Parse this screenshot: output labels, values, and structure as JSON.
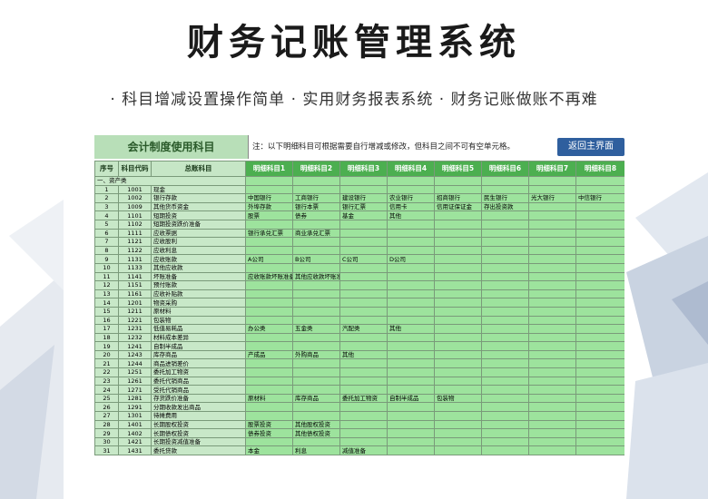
{
  "hero": {
    "title": "财务记账管理系统",
    "subtitle": "· 科目增减设置操作简单  ·  实用财务报表系统 · 财务记账做账不再难"
  },
  "sheet": {
    "title": "会计制度使用科目",
    "note": "注：以下明细科目可根据需要自行增减或修改，但科目之间不可有空单元格。",
    "back_button": "返回主界面",
    "headers": [
      "序号",
      "科目代码",
      "总账科目",
      "明细科目1",
      "明细科目2",
      "明细科目3",
      "明细科目4",
      "明细科目5",
      "明细科目6",
      "明细科目7",
      "明细科目8"
    ],
    "section": "一、资产类",
    "rows": [
      {
        "seq": "1",
        "code": "1001",
        "name": "现金",
        "details": []
      },
      {
        "seq": "2",
        "code": "1002",
        "name": "银行存款",
        "details": [
          "中国银行",
          "工商银行",
          "建设银行",
          "农业银行",
          "招商银行",
          "民生银行",
          "光大银行",
          "中信银行"
        ]
      },
      {
        "seq": "3",
        "code": "1009",
        "name": "其他货币资金",
        "details": [
          "外埠存款",
          "银行本票",
          "银行汇票",
          "信用卡",
          "信用证保证金",
          "存出投资款"
        ]
      },
      {
        "seq": "4",
        "code": "1101",
        "name": "短期投资",
        "details": [
          "股票",
          "债券",
          "基金",
          "其他"
        ]
      },
      {
        "seq": "5",
        "code": "1102",
        "name": "短期投资跌价准备",
        "details": []
      },
      {
        "seq": "6",
        "code": "1111",
        "name": "应收票据",
        "details": [
          "银行承兑汇票",
          "商业承兑汇票"
        ]
      },
      {
        "seq": "7",
        "code": "1121",
        "name": "应收股利",
        "details": []
      },
      {
        "seq": "8",
        "code": "1122",
        "name": "应收利息",
        "details": []
      },
      {
        "seq": "9",
        "code": "1131",
        "name": "应收账款",
        "details": [
          "A公司",
          "B公司",
          "C公司",
          "D公司"
        ]
      },
      {
        "seq": "10",
        "code": "1133",
        "name": "其他应收款",
        "details": []
      },
      {
        "seq": "11",
        "code": "1141",
        "name": "坏账准备",
        "details": [
          "应收账款坏账准备",
          "其他应收款坏账准备"
        ]
      },
      {
        "seq": "12",
        "code": "1151",
        "name": "预付账款",
        "details": []
      },
      {
        "seq": "13",
        "code": "1161",
        "name": "应收补贴款",
        "details": []
      },
      {
        "seq": "14",
        "code": "1201",
        "name": "物资采购",
        "details": []
      },
      {
        "seq": "15",
        "code": "1211",
        "name": "原材料",
        "details": []
      },
      {
        "seq": "16",
        "code": "1221",
        "name": "包装物",
        "details": []
      },
      {
        "seq": "17",
        "code": "1231",
        "name": "低值易耗品",
        "details": [
          "办公类",
          "五金类",
          "汽配类",
          "其他"
        ]
      },
      {
        "seq": "18",
        "code": "1232",
        "name": "材料成本差异",
        "details": []
      },
      {
        "seq": "19",
        "code": "1241",
        "name": "自制半成品",
        "details": []
      },
      {
        "seq": "20",
        "code": "1243",
        "name": "库存商品",
        "details": [
          "产成品",
          "外购商品",
          "其他"
        ]
      },
      {
        "seq": "21",
        "code": "1244",
        "name": "商品进销差价",
        "details": []
      },
      {
        "seq": "22",
        "code": "1251",
        "name": "委托加工物资",
        "details": []
      },
      {
        "seq": "23",
        "code": "1261",
        "name": "委托代销商品",
        "details": []
      },
      {
        "seq": "24",
        "code": "1271",
        "name": "受托代销商品",
        "details": []
      },
      {
        "seq": "25",
        "code": "1281",
        "name": "存货跌价准备",
        "details": [
          "原材料",
          "库存商品",
          "委托加工物资",
          "自制半成品",
          "包装物"
        ]
      },
      {
        "seq": "26",
        "code": "1291",
        "name": "分期收款发出商品",
        "details": []
      },
      {
        "seq": "27",
        "code": "1301",
        "name": "待摊费用",
        "details": []
      },
      {
        "seq": "28",
        "code": "1401",
        "name": "长期股权投资",
        "details": [
          "股票投资",
          "其他股权投资"
        ]
      },
      {
        "seq": "29",
        "code": "1402",
        "name": "长期债权投资",
        "details": [
          "债券投资",
          "其他债权投资"
        ]
      },
      {
        "seq": "30",
        "code": "1421",
        "name": "长期投资减值准备",
        "details": []
      },
      {
        "seq": "31",
        "code": "1431",
        "name": "委托贷款",
        "details": [
          "本金",
          "利息",
          "减值准备"
        ]
      }
    ]
  }
}
